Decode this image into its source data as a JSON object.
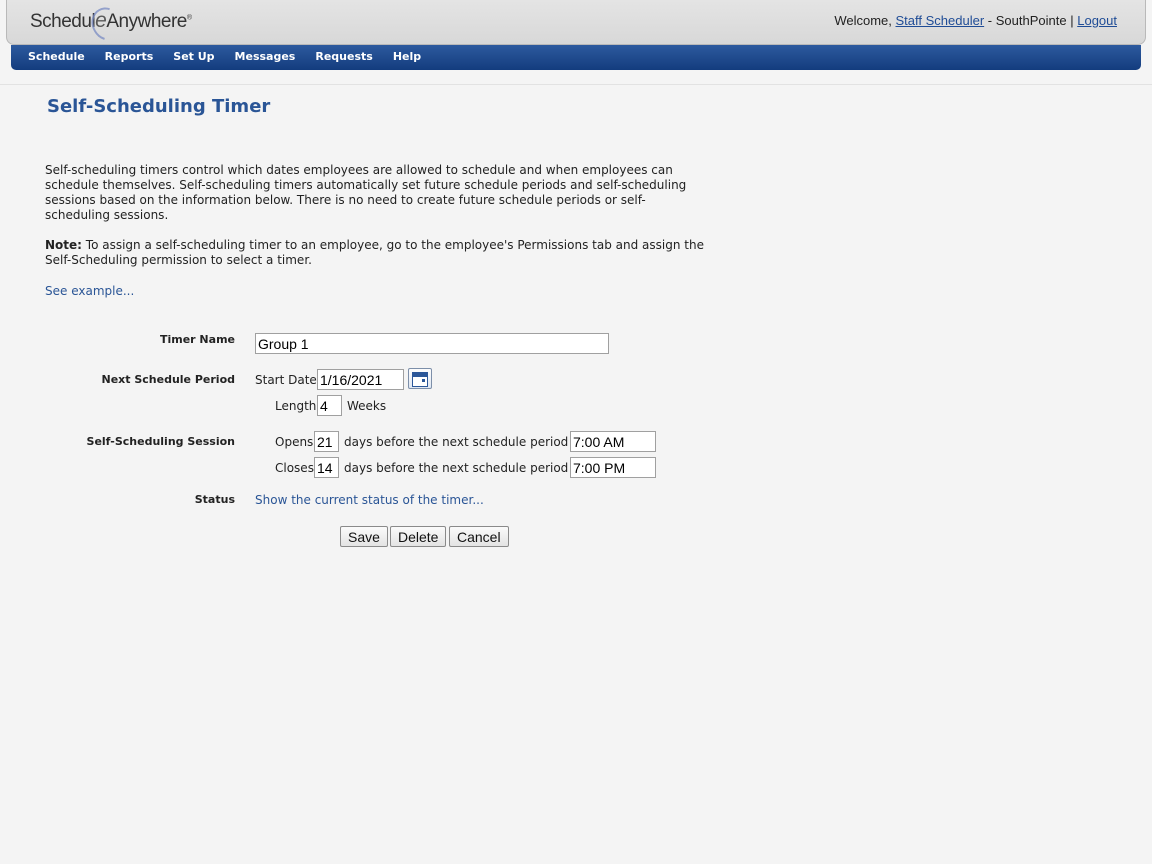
{
  "header": {
    "logo_part1": "Schedul",
    "logo_part2": "e",
    "logo_part3": "Anywhere",
    "welcome_text": "Welcome,",
    "user_link": "Staff Scheduler",
    "separator1": "-",
    "location": "SouthPointe",
    "separator2": "|",
    "logout_link": "Logout"
  },
  "nav": {
    "items": [
      "Schedule",
      "Reports",
      "Set Up",
      "Messages",
      "Requests",
      "Help"
    ]
  },
  "page": {
    "title": "Self-Scheduling Timer",
    "intro": "Self-scheduling timers control which dates employees are allowed to schedule and when employees can schedule themselves. Self-scheduling timers automatically set future schedule periods and self-scheduling sessions based on the information below. There is no need to create future schedule periods or self-scheduling sessions.",
    "note_label": "Note:",
    "note_text": "To assign a self-scheduling timer to an employee, go to the employee's Permissions tab and assign the Self-Scheduling permission to select a timer.",
    "see_example": "See example..."
  },
  "form": {
    "timer_name_label": "Timer Name",
    "timer_name_value": "Group 1",
    "next_period_label": "Next Schedule Period",
    "start_date_label": "Start Date",
    "start_date_value": "1/16/2021",
    "length_label": "Length",
    "length_value": "4",
    "length_unit": "Weeks",
    "session_label": "Self-Scheduling Session",
    "opens_label": "Opens",
    "opens_value": "21",
    "opens_text": "days before the next schedule period at",
    "opens_time": "7:00 AM",
    "closes_label": "Closes",
    "closes_value": "14",
    "closes_text": "days before the next schedule period at",
    "closes_time": "7:00 PM",
    "status_label": "Status",
    "status_link": "Show the current status of the timer..."
  },
  "buttons": {
    "save": "Save",
    "delete": "Delete",
    "cancel": "Cancel"
  },
  "colors": {
    "nav_bg": "#1f4a8c",
    "title": "#2a5596",
    "link": "#2a5596",
    "page_bg": "#f4f4f4"
  }
}
